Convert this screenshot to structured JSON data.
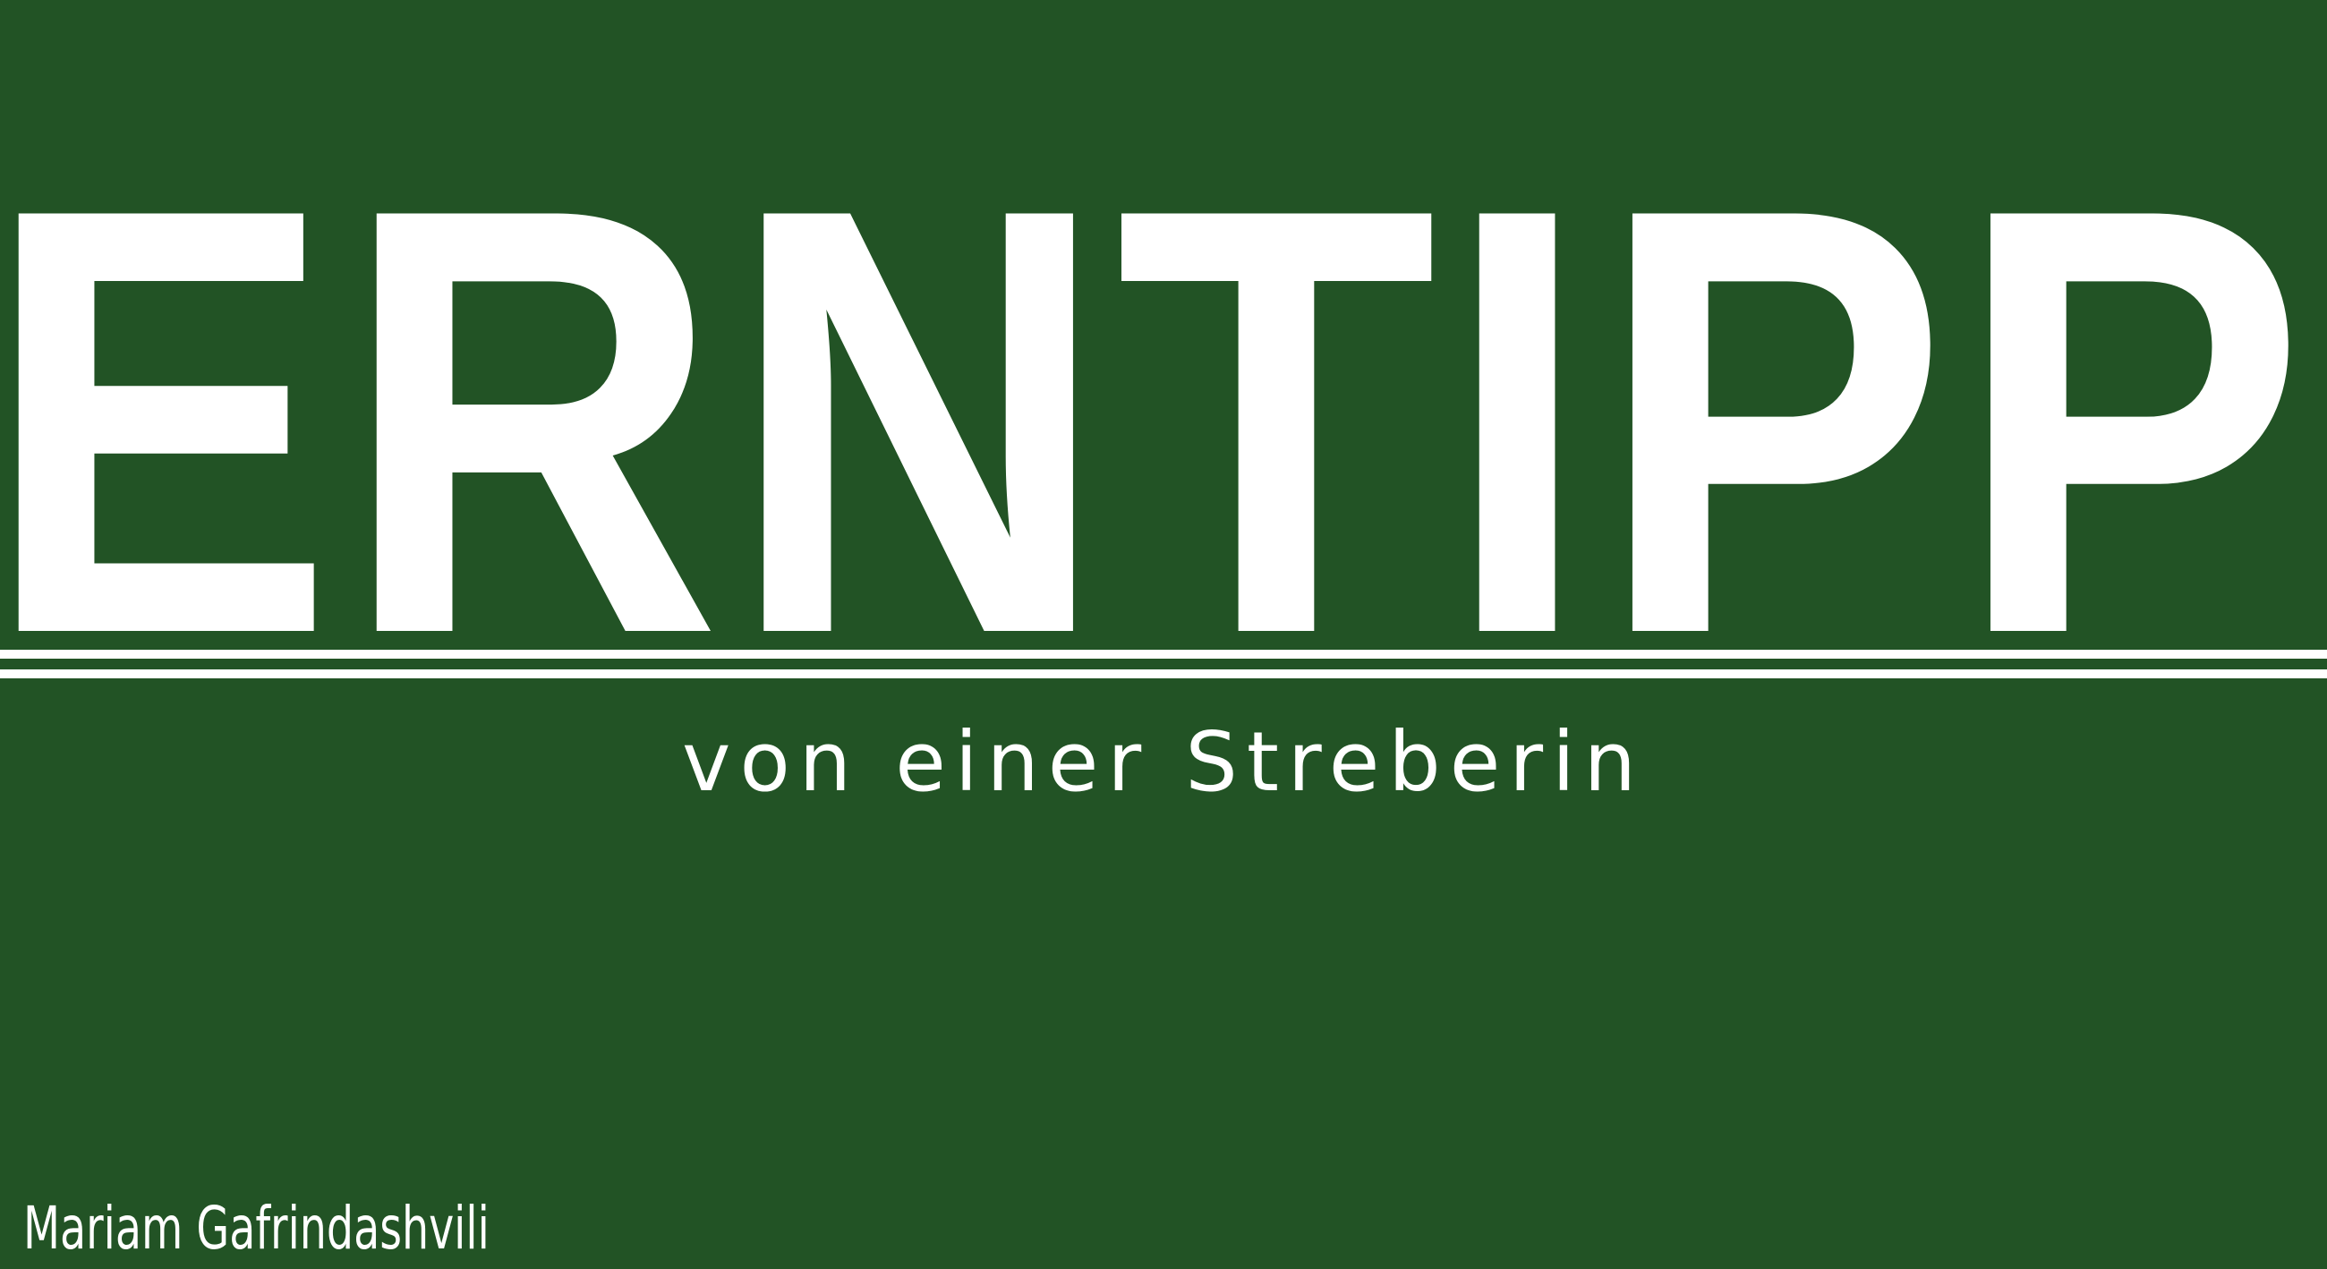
{
  "cover": {
    "title": "LERNTIPPS",
    "subtitle": "von einer Streberin",
    "author": "Mariam Gafrindashvili"
  },
  "colors": {
    "background": "#225325",
    "text": "#ffffff",
    "rule": "#ffffff"
  }
}
